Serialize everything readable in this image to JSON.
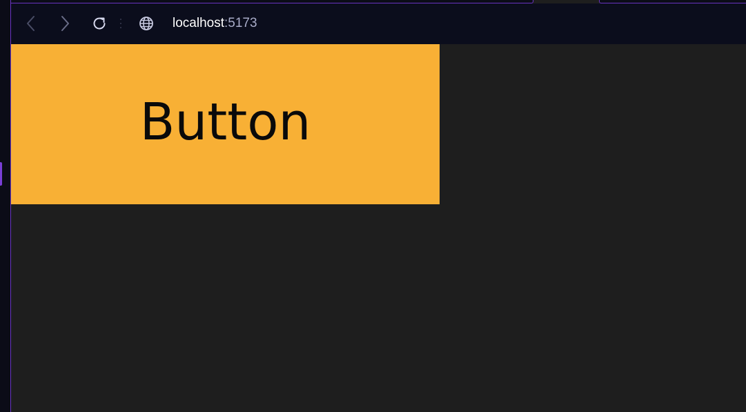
{
  "browser": {
    "address_bar": {
      "host": "localhost",
      "port": ":5173"
    },
    "icons": {
      "back": "chevron-left-icon",
      "forward": "chevron-right-icon",
      "reload": "reload-icon",
      "site_info": "globe-icon"
    }
  },
  "page": {
    "button_label": "Button",
    "button_color": "#f8b035",
    "background_color": "#1e1e1e"
  }
}
